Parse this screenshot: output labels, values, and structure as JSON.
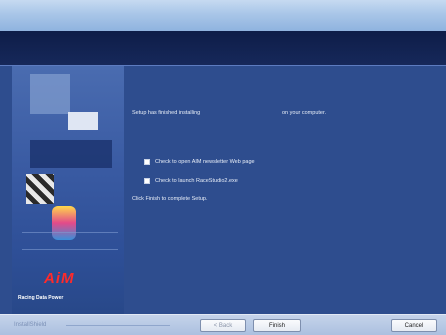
{
  "window": {
    "title": ""
  },
  "banner": {
    "logo_text": "AiM",
    "credit": "Racing Data Power"
  },
  "content": {
    "finished_text": "Setup has finished installing",
    "computer_text": "on your computer.",
    "checkbox_newsletter_label": "Check to open AIM newsletter Web page",
    "checkbox_newsletter_checked": false,
    "checkbox_launch_label": "Check to launch RaceStudio2.exe",
    "checkbox_launch_checked": false,
    "complete_text": "Click Finish to complete Setup."
  },
  "footer": {
    "brand": "InstallShield",
    "back_label": "< Back",
    "finish_label": "Finish",
    "cancel_label": "Cancel"
  },
  "colors": {
    "background": "#2e4d8e",
    "header": "#0e1d48",
    "logo": "#ff2a2a"
  }
}
